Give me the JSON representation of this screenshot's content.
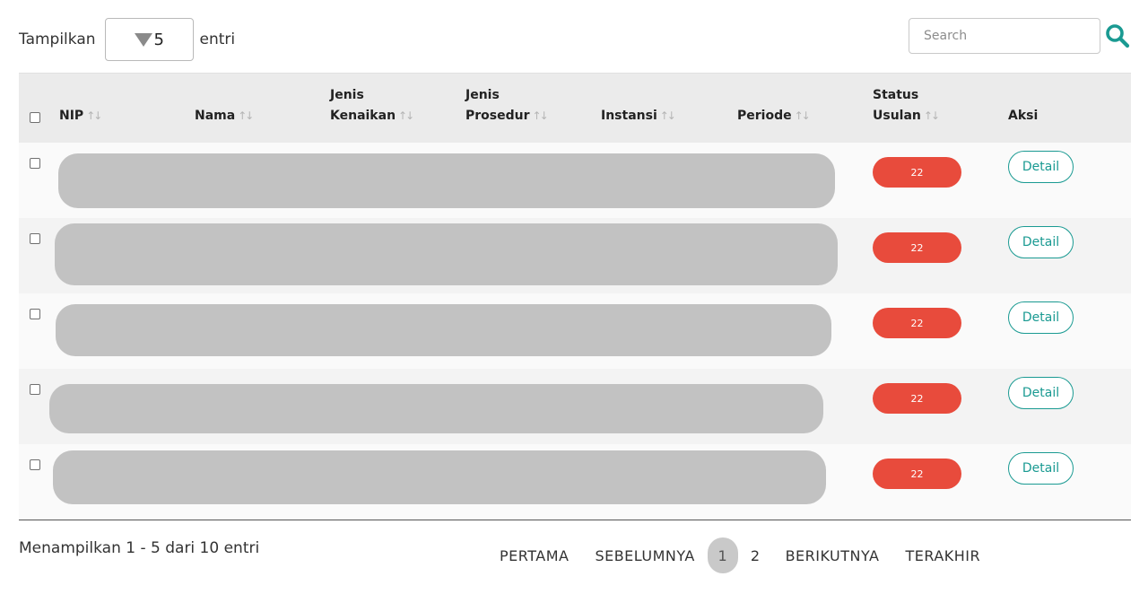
{
  "length_menu": {
    "prefix": "Tampilkan",
    "value": "5",
    "suffix": "entri"
  },
  "search": {
    "placeholder": "Search"
  },
  "table": {
    "headers": {
      "nip": "NIP",
      "nama": "Nama",
      "jenis_kenaikan_1": "Jenis",
      "jenis_kenaikan_2": "Kenaikan",
      "jenis_prosedur_1": "Jenis",
      "jenis_prosedur_2": "Prosedur",
      "instansi": "Instansi",
      "periode": "Periode",
      "status_1": "Status",
      "status_2": "Usulan",
      "aksi": "Aksi"
    },
    "sort_icon": "↑↓",
    "rows": [
      {
        "status": "22",
        "action": "Detail"
      },
      {
        "status": "22",
        "action": "Detail"
      },
      {
        "status": "22",
        "action": "Detail"
      },
      {
        "status": "22",
        "action": "Detail"
      },
      {
        "status": "22",
        "action": "Detail"
      }
    ]
  },
  "footer": {
    "info": "Menampilkan 1 - 5 dari 10 entri",
    "pagination": {
      "first": "PERTAMA",
      "prev": "SEBELUMNYA",
      "page1": "1",
      "page2": "2",
      "next": "BERIKUTNYA",
      "last": "TERAKHIR"
    }
  },
  "colors": {
    "accent": "#1a9a92",
    "status_badge": "#e84b3c",
    "header_bg": "#ebebeb",
    "redaction": "#c2c2c2"
  }
}
